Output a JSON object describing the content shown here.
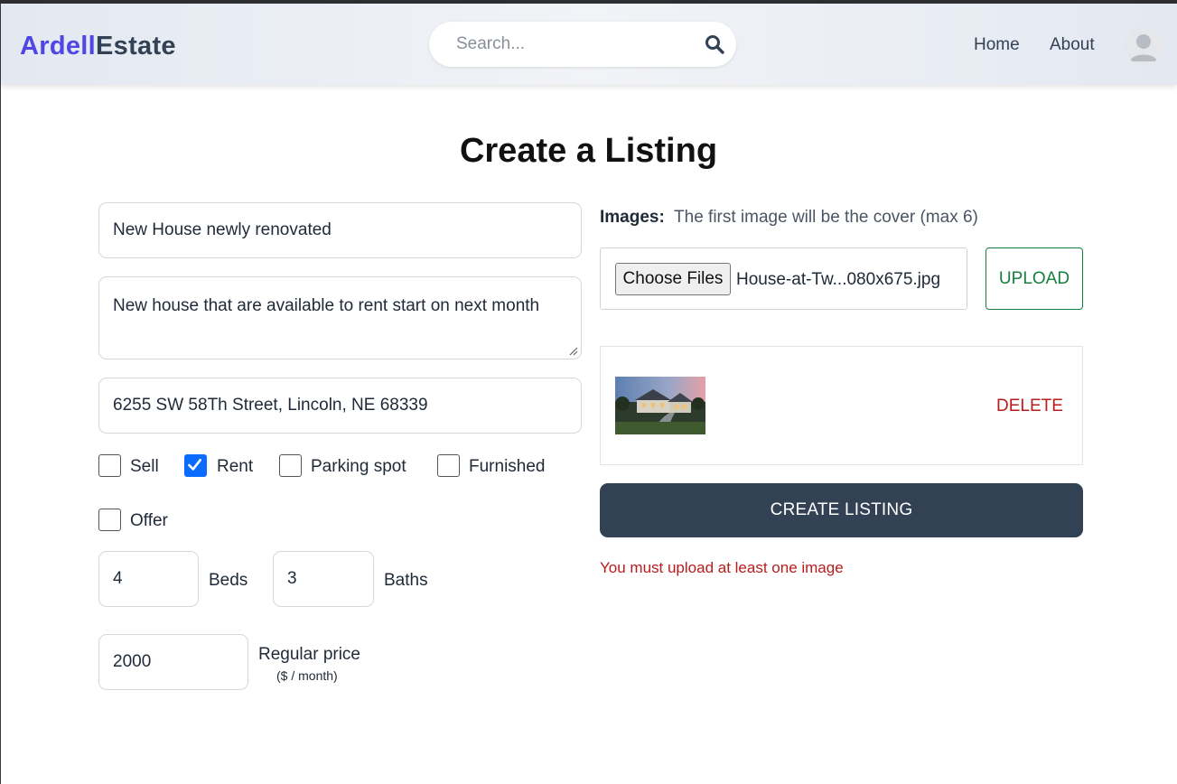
{
  "header": {
    "logo_part1": "Ardell",
    "logo_part2": "Estate",
    "search_placeholder": "Search...",
    "nav": [
      "Home",
      "About"
    ]
  },
  "page_title": "Create a Listing",
  "form": {
    "name_value": "New House newly renovated",
    "description_value": "New house that are available to rent start on next month",
    "address_value": "6255 SW 58Th Street, Lincoln, NE 68339",
    "checkboxes": [
      {
        "label": "Sell",
        "checked": false
      },
      {
        "label": "Rent",
        "checked": true
      },
      {
        "label": "Parking spot",
        "checked": false
      },
      {
        "label": "Furnished",
        "checked": false
      },
      {
        "label": "Offer",
        "checked": false
      }
    ],
    "beds_value": "4",
    "beds_label": "Beds",
    "baths_value": "3",
    "baths_label": "Baths",
    "price_value": "2000",
    "price_label": "Regular price",
    "price_sublabel": "($ / month)"
  },
  "images": {
    "label": "Images:",
    "hint": "The first image will be the cover (max 6)",
    "choose_label": "Choose Files",
    "file_name": "House-at-Tw...080x675.jpg",
    "upload_label": "UPLOAD",
    "delete_label": "DELETE"
  },
  "submit_label": "CREATE LISTING",
  "error_message": "You must upload at least one image",
  "colors": {
    "brand_primary": "#4f46e5",
    "brand_secondary": "#334155",
    "upload_green": "#15803d",
    "error_red": "#b91c1c",
    "checkbox_blue": "#0a6cff"
  }
}
